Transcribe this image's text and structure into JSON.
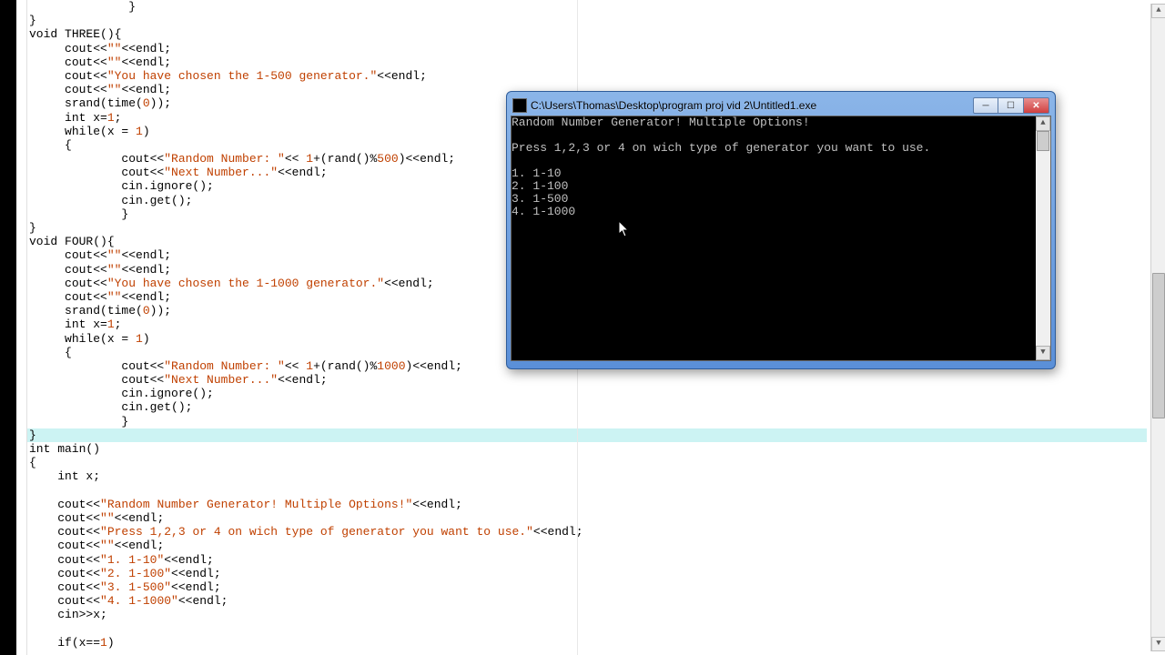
{
  "code_lines": [
    {
      "indent": 14,
      "segs": [
        {
          "t": "}",
          "c": "kw"
        }
      ]
    },
    {
      "indent": 0,
      "segs": [
        {
          "t": "}",
          "c": "kw"
        }
      ]
    },
    {
      "indent": 0,
      "segs": [
        {
          "t": "void",
          "c": "kw"
        },
        {
          "t": " THREE(){",
          "c": ""
        }
      ]
    },
    {
      "indent": 5,
      "segs": [
        {
          "t": "cout<<",
          "c": ""
        },
        {
          "t": "\"\"",
          "c": "str"
        },
        {
          "t": "<<endl;",
          "c": ""
        }
      ]
    },
    {
      "indent": 5,
      "segs": [
        {
          "t": "cout<<",
          "c": ""
        },
        {
          "t": "\"\"",
          "c": "str"
        },
        {
          "t": "<<endl;",
          "c": ""
        }
      ]
    },
    {
      "indent": 5,
      "segs": [
        {
          "t": "cout<<",
          "c": ""
        },
        {
          "t": "\"You have chosen the 1-500 generator.\"",
          "c": "str"
        },
        {
          "t": "<<endl;",
          "c": ""
        }
      ]
    },
    {
      "indent": 5,
      "segs": [
        {
          "t": "cout<<",
          "c": ""
        },
        {
          "t": "\"\"",
          "c": "str"
        },
        {
          "t": "<<endl;",
          "c": ""
        }
      ]
    },
    {
      "indent": 5,
      "segs": [
        {
          "t": "srand(time(",
          "c": ""
        },
        {
          "t": "0",
          "c": "num"
        },
        {
          "t": "));",
          "c": ""
        }
      ]
    },
    {
      "indent": 5,
      "segs": [
        {
          "t": "int",
          "c": "kw"
        },
        {
          "t": " x=",
          "c": ""
        },
        {
          "t": "1",
          "c": "num"
        },
        {
          "t": ";",
          "c": ""
        }
      ]
    },
    {
      "indent": 5,
      "segs": [
        {
          "t": "while",
          "c": "kw"
        },
        {
          "t": "(x = ",
          "c": ""
        },
        {
          "t": "1",
          "c": "num"
        },
        {
          "t": ")",
          "c": ""
        }
      ]
    },
    {
      "indent": 5,
      "segs": [
        {
          "t": "{",
          "c": ""
        }
      ]
    },
    {
      "indent": 13,
      "segs": [
        {
          "t": "cout<<",
          "c": ""
        },
        {
          "t": "\"Random Number: \"",
          "c": "str"
        },
        {
          "t": "<< ",
          "c": ""
        },
        {
          "t": "1",
          "c": "num"
        },
        {
          "t": "+(rand()%",
          "c": ""
        },
        {
          "t": "500",
          "c": "num"
        },
        {
          "t": ")<<endl;",
          "c": ""
        }
      ]
    },
    {
      "indent": 13,
      "segs": [
        {
          "t": "cout<<",
          "c": ""
        },
        {
          "t": "\"Next Number...\"",
          "c": "str"
        },
        {
          "t": "<<endl;",
          "c": ""
        }
      ]
    },
    {
      "indent": 13,
      "segs": [
        {
          "t": "cin.ignore();",
          "c": ""
        }
      ]
    },
    {
      "indent": 13,
      "segs": [
        {
          "t": "cin.get();",
          "c": ""
        }
      ]
    },
    {
      "indent": 13,
      "segs": [
        {
          "t": "}",
          "c": ""
        }
      ]
    },
    {
      "indent": 0,
      "segs": [
        {
          "t": "}",
          "c": ""
        }
      ]
    },
    {
      "indent": 0,
      "segs": [
        {
          "t": "void",
          "c": "kw"
        },
        {
          "t": " FOUR(){",
          "c": ""
        }
      ]
    },
    {
      "indent": 5,
      "segs": [
        {
          "t": "cout<<",
          "c": ""
        },
        {
          "t": "\"\"",
          "c": "str"
        },
        {
          "t": "<<endl;",
          "c": ""
        }
      ]
    },
    {
      "indent": 5,
      "segs": [
        {
          "t": "cout<<",
          "c": ""
        },
        {
          "t": "\"\"",
          "c": "str"
        },
        {
          "t": "<<endl;",
          "c": ""
        }
      ]
    },
    {
      "indent": 5,
      "segs": [
        {
          "t": "cout<<",
          "c": ""
        },
        {
          "t": "\"You have chosen the 1-1000 generator.\"",
          "c": "str"
        },
        {
          "t": "<<endl;",
          "c": ""
        }
      ]
    },
    {
      "indent": 5,
      "segs": [
        {
          "t": "cout<<",
          "c": ""
        },
        {
          "t": "\"\"",
          "c": "str"
        },
        {
          "t": "<<endl;",
          "c": ""
        }
      ]
    },
    {
      "indent": 5,
      "segs": [
        {
          "t": "srand(time(",
          "c": ""
        },
        {
          "t": "0",
          "c": "num"
        },
        {
          "t": "));",
          "c": ""
        }
      ]
    },
    {
      "indent": 5,
      "segs": [
        {
          "t": "int",
          "c": "kw"
        },
        {
          "t": " x=",
          "c": ""
        },
        {
          "t": "1",
          "c": "num"
        },
        {
          "t": ";",
          "c": ""
        }
      ]
    },
    {
      "indent": 5,
      "segs": [
        {
          "t": "while",
          "c": "kw"
        },
        {
          "t": "(x = ",
          "c": ""
        },
        {
          "t": "1",
          "c": "num"
        },
        {
          "t": ")",
          "c": ""
        }
      ]
    },
    {
      "indent": 5,
      "segs": [
        {
          "t": "{",
          "c": ""
        }
      ]
    },
    {
      "indent": 13,
      "segs": [
        {
          "t": "cout<<",
          "c": ""
        },
        {
          "t": "\"Random Number: \"",
          "c": "str"
        },
        {
          "t": "<< ",
          "c": ""
        },
        {
          "t": "1",
          "c": "num"
        },
        {
          "t": "+(rand()%",
          "c": ""
        },
        {
          "t": "1000",
          "c": "num"
        },
        {
          "t": ")<<endl;",
          "c": ""
        }
      ]
    },
    {
      "indent": 13,
      "segs": [
        {
          "t": "cout<<",
          "c": ""
        },
        {
          "t": "\"Next Number...\"",
          "c": "str"
        },
        {
          "t": "<<endl;",
          "c": ""
        }
      ]
    },
    {
      "indent": 13,
      "segs": [
        {
          "t": "cin.ignore();",
          "c": ""
        }
      ]
    },
    {
      "indent": 13,
      "segs": [
        {
          "t": "cin.get();",
          "c": ""
        }
      ]
    },
    {
      "indent": 13,
      "segs": [
        {
          "t": "}",
          "c": ""
        }
      ]
    },
    {
      "indent": 0,
      "segs": [
        {
          "t": "}",
          "c": ""
        }
      ],
      "hl": true
    },
    {
      "indent": 0,
      "segs": [
        {
          "t": "int",
          "c": "kw"
        },
        {
          "t": " main()",
          "c": ""
        }
      ]
    },
    {
      "indent": 0,
      "segs": [
        {
          "t": "{",
          "c": ""
        }
      ]
    },
    {
      "indent": 4,
      "segs": [
        {
          "t": "int",
          "c": "kw"
        },
        {
          "t": " x;",
          "c": ""
        }
      ]
    },
    {
      "indent": 0,
      "segs": []
    },
    {
      "indent": 4,
      "segs": [
        {
          "t": "cout<<",
          "c": ""
        },
        {
          "t": "\"Random Number Generator! Multiple Options!\"",
          "c": "str"
        },
        {
          "t": "<<endl;",
          "c": ""
        }
      ]
    },
    {
      "indent": 4,
      "segs": [
        {
          "t": "cout<<",
          "c": ""
        },
        {
          "t": "\"\"",
          "c": "str"
        },
        {
          "t": "<<endl;",
          "c": ""
        }
      ]
    },
    {
      "indent": 4,
      "segs": [
        {
          "t": "cout<<",
          "c": ""
        },
        {
          "t": "\"Press 1,2,3 or 4 on wich type of generator you want to use.\"",
          "c": "str"
        },
        {
          "t": "<<endl;",
          "c": ""
        }
      ]
    },
    {
      "indent": 4,
      "segs": [
        {
          "t": "cout<<",
          "c": ""
        },
        {
          "t": "\"\"",
          "c": "str"
        },
        {
          "t": "<<endl;",
          "c": ""
        }
      ]
    },
    {
      "indent": 4,
      "segs": [
        {
          "t": "cout<<",
          "c": ""
        },
        {
          "t": "\"1. 1-10\"",
          "c": "str"
        },
        {
          "t": "<<endl;",
          "c": ""
        }
      ]
    },
    {
      "indent": 4,
      "segs": [
        {
          "t": "cout<<",
          "c": ""
        },
        {
          "t": "\"2. 1-100\"",
          "c": "str"
        },
        {
          "t": "<<endl;",
          "c": ""
        }
      ]
    },
    {
      "indent": 4,
      "segs": [
        {
          "t": "cout<<",
          "c": ""
        },
        {
          "t": "\"3. 1-500\"",
          "c": "str"
        },
        {
          "t": "<<endl;",
          "c": ""
        }
      ]
    },
    {
      "indent": 4,
      "segs": [
        {
          "t": "cout<<",
          "c": ""
        },
        {
          "t": "\"4. 1-1000\"",
          "c": "str"
        },
        {
          "t": "<<endl;",
          "c": ""
        }
      ]
    },
    {
      "indent": 4,
      "segs": [
        {
          "t": "cin>>x;",
          "c": ""
        }
      ]
    },
    {
      "indent": 0,
      "segs": []
    },
    {
      "indent": 4,
      "segs": [
        {
          "t": "if",
          "c": "kw"
        },
        {
          "t": "(x==",
          "c": ""
        },
        {
          "t": "1",
          "c": "num"
        },
        {
          "t": ")",
          "c": ""
        }
      ]
    }
  ],
  "console": {
    "title": "C:\\Users\\Thomas\\Desktop\\program proj vid 2\\Untitled1.exe",
    "output": "Random Number Generator! Multiple Options!\n\nPress 1,2,3 or 4 on wich type of generator you want to use.\n\n1. 1-10\n2. 1-100\n3. 1-500\n4. 1-1000"
  },
  "window_buttons": {
    "min": "─",
    "max": "☐",
    "close": "✕"
  },
  "scroll_arrows": {
    "up": "▲",
    "down": "▼"
  }
}
